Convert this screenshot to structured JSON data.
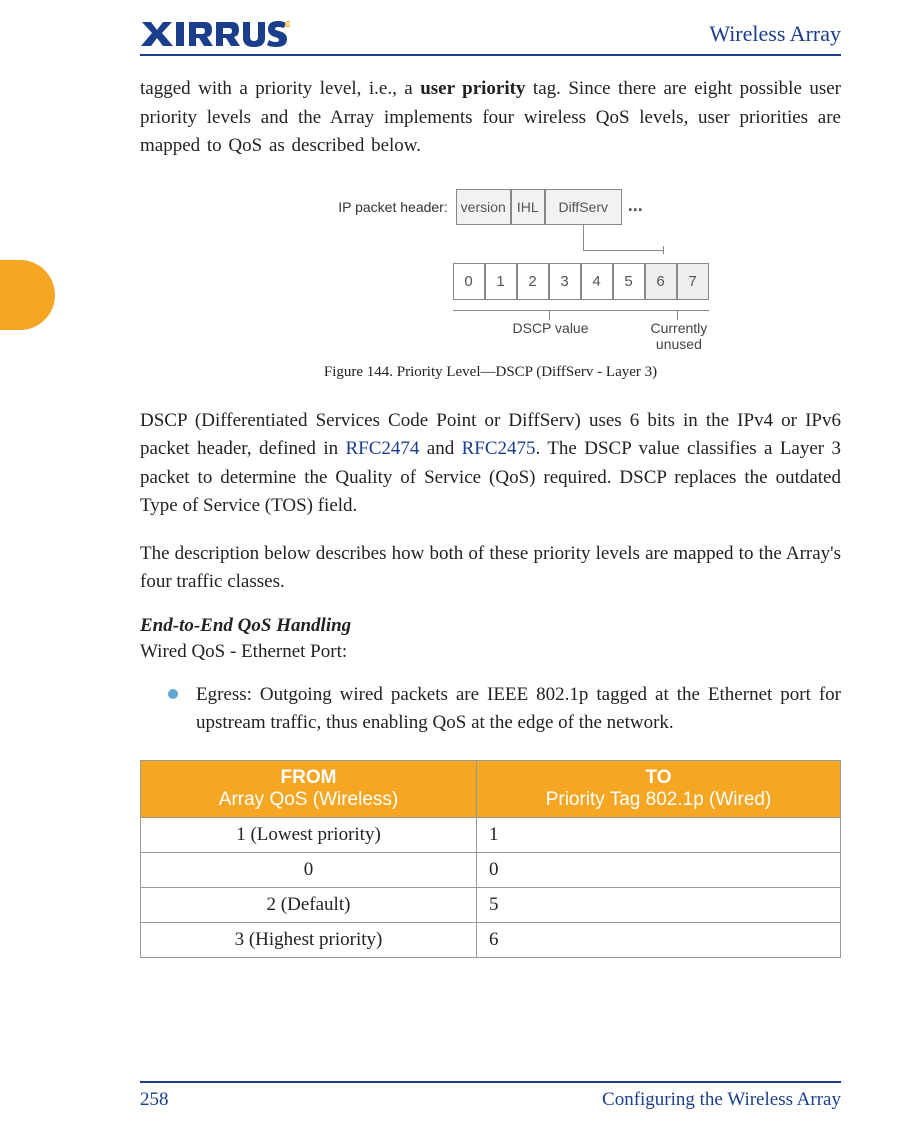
{
  "header": {
    "doc_title": "Wireless Array",
    "logo_text": "XIRRUS"
  },
  "para1_a": "tagged with a priority level, i.e., a ",
  "para1_bold": "user priority",
  "para1_b": " tag. Since there are eight possible user priority levels and the Array implements four wireless QoS levels, user priorities are mapped to QoS as described below.",
  "diagram": {
    "label": "IP packet header:",
    "cells": {
      "version": "version",
      "ihl": "IHL",
      "diffserv": "DiffServ",
      "dots": "..."
    },
    "bits": [
      "0",
      "1",
      "2",
      "3",
      "4",
      "5",
      "6",
      "7"
    ],
    "dscp_label": "DSCP value",
    "unused_label_1": "Currently",
    "unused_label_2": "unused"
  },
  "fig_caption": "Figure 144. Priority Level—DSCP (DiffServ - Layer 3)",
  "para2_a": "DSCP (Differentiated Services Code Point or DiffServ) uses 6 bits in the IPv4 or IPv6 packet header, defined in ",
  "para2_link1": "RFC2474",
  "para2_b": " and ",
  "para2_link2": "RFC2475",
  "para2_c": ". The DSCP value classifies a Layer 3 packet to determine the Quality of Service (QoS) required. DSCP replaces the outdated Type of Service (TOS) field.",
  "para3": "The description below describes how both of these priority levels are mapped to the Array's four traffic classes.",
  "section_header": "End-to-End QoS Handling",
  "section_sub": "Wired QoS - Ethernet Port:",
  "bullet1": "Egress: Outgoing wired packets are IEEE 802.1p tagged at the Ethernet port for upstream traffic, thus enabling QoS at the edge of the network.",
  "table": {
    "col1_top": "FROM",
    "col1_sub": "Array QoS (Wireless)",
    "col2_top": "TO",
    "col2_sub": "Priority Tag 802.1p (Wired)",
    "rows": [
      {
        "from": "1 (Lowest priority)",
        "to": "1"
      },
      {
        "from": "0",
        "to": "0"
      },
      {
        "from": "2 (Default)",
        "to": "5"
      },
      {
        "from": "3 (Highest priority)",
        "to": "6"
      }
    ]
  },
  "footer": {
    "page": "258",
    "section": "Configuring the Wireless Array"
  }
}
